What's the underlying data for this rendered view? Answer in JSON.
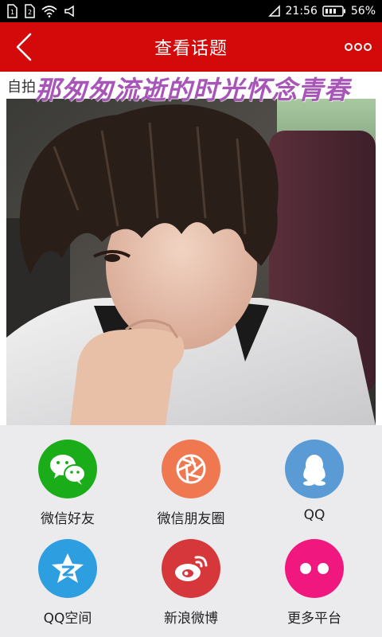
{
  "status_bar": {
    "time": "21:56",
    "battery": "56%"
  },
  "header": {
    "title": "查看话题",
    "back_icon": "chevron-left-icon",
    "more_icon": "more-dots-icon",
    "background_color": "#d40a0a"
  },
  "topic": {
    "label": "自拍",
    "headline": "那匆匆流逝的时光怀念青春",
    "headline_color": "#a855b8"
  },
  "share": {
    "items": [
      {
        "label": "微信好友",
        "icon": "wechat-icon",
        "color": "#1aad19"
      },
      {
        "label": "微信朋友圈",
        "icon": "wechat-moments-icon",
        "color": "#f07850"
      },
      {
        "label": "QQ",
        "icon": "qq-icon",
        "color": "#5b9bd5"
      },
      {
        "label": "QQ空间",
        "icon": "qzone-icon",
        "color": "#2d9ee0"
      },
      {
        "label": "新浪微博",
        "icon": "weibo-icon",
        "color": "#d6373a"
      },
      {
        "label": "更多平台",
        "icon": "more-platforms-icon",
        "color": "#f0177f"
      }
    ]
  }
}
